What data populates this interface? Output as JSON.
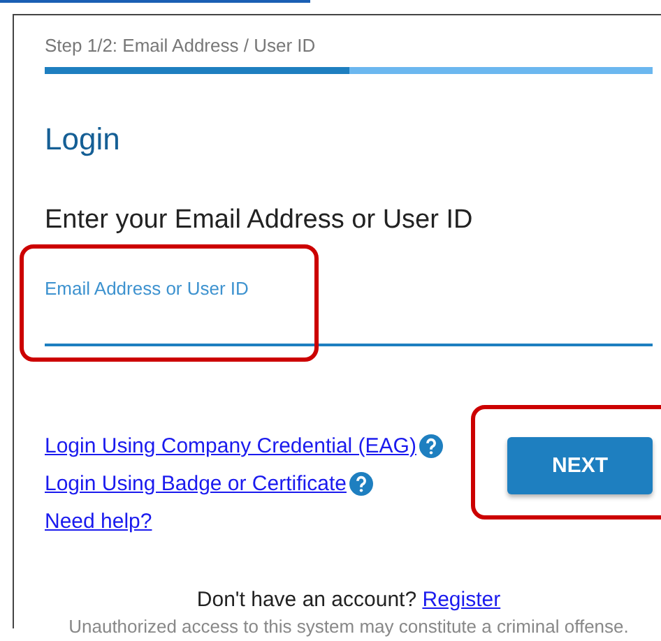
{
  "step": {
    "label": "Step 1/2: Email Address / User ID",
    "level": 0.5
  },
  "title": "Login",
  "heading": "Enter your Email Address or User ID",
  "field": {
    "label": "Email Address or User ID",
    "focused": true,
    "highlighted": true
  },
  "links": [
    {
      "label": "Login Using Company Credential (EAG)",
      "help": true
    },
    {
      "label": "Login Using Badge or Certificate",
      "help": true
    },
    {
      "label": "Need help?",
      "help": false
    }
  ],
  "next_button": {
    "label": "NEXT",
    "highlighted": true
  },
  "register": {
    "prompt": "Don't have an account?",
    "link": "Register"
  },
  "notice": "Unauthorized access to this system may constitute a criminal offense."
}
